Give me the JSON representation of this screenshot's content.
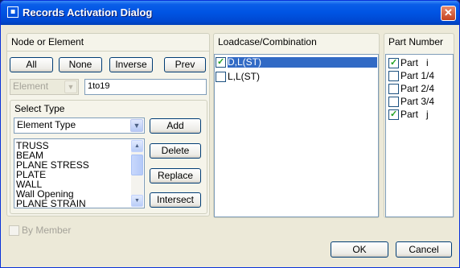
{
  "window": {
    "title": "Records Activation Dialog",
    "icon": "app-icon",
    "close_label": "✕"
  },
  "node_or_element": {
    "title": "Node or Element",
    "buttons": [
      "All",
      "None",
      "Inverse",
      "Prev"
    ],
    "type_combo": {
      "value": "Element",
      "enabled": false
    },
    "range_input": "1to19",
    "select_type": {
      "title": "Select Type",
      "combo_value": "Element Type",
      "list_items": [
        "TRUSS",
        "BEAM",
        "PLANE STRESS",
        "PLATE",
        "WALL",
        "Wall Opening",
        "PLANE STRAIN"
      ],
      "buttons": [
        "Add",
        "Delete",
        "Replace",
        "Intersect"
      ]
    }
  },
  "by_member": {
    "label": "By Member",
    "checked": false,
    "enabled": false
  },
  "loadcase": {
    "title": "Loadcase/Combination",
    "items": [
      {
        "label": "D,L(ST)",
        "checked": true,
        "selected": true
      },
      {
        "label": "L,L(ST)",
        "checked": false,
        "selected": false
      }
    ]
  },
  "part_number": {
    "title": "Part Number",
    "items": [
      {
        "label": "Part   i",
        "checked": true
      },
      {
        "label": "Part 1/4",
        "checked": false
      },
      {
        "label": "Part 2/4",
        "checked": false
      },
      {
        "label": "Part 3/4",
        "checked": false
      },
      {
        "label": "Part   j",
        "checked": true
      }
    ]
  },
  "footer": {
    "ok_label": "OK",
    "cancel_label": "Cancel"
  },
  "colors": {
    "title_bar": "#0054e3",
    "dialog_bg": "#ece9d8",
    "selection": "#316ac5",
    "check": "#21a121"
  }
}
